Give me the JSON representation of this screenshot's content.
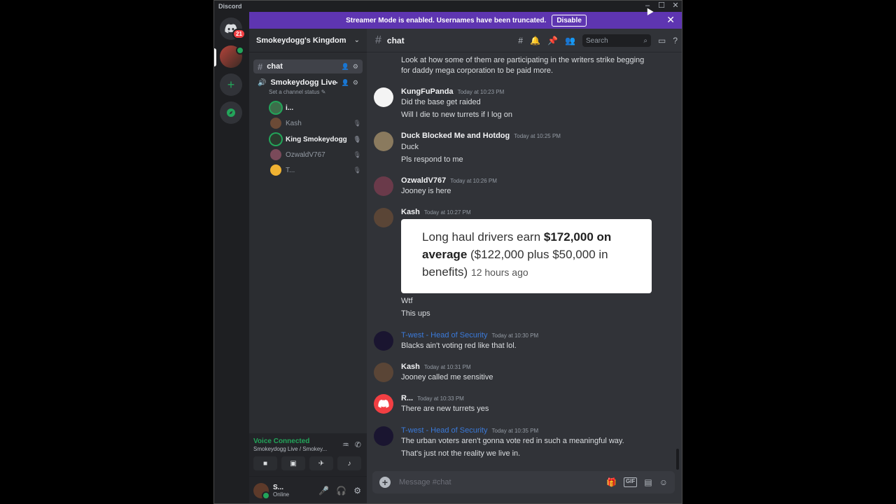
{
  "window": {
    "title": "Discord"
  },
  "rail": {
    "dm_badge": "21"
  },
  "banner": {
    "text": "Streamer Mode is enabled. Usernames have been truncated.",
    "button": "Disable"
  },
  "sidebar": {
    "server_name": "Smokeydogg's Kingdom",
    "text_channel": "chat",
    "voice_channel": "Smokeydogg Live",
    "voice_status": "Set a channel status",
    "voice_users": [
      "i...",
      "Kash",
      "King Smokeydogg",
      "OzwaldV767",
      "T..."
    ]
  },
  "voice_panel": {
    "status": "Voice Connected",
    "location": "Smokeydogg Live / Smokey..."
  },
  "user": {
    "name": "S...",
    "status": "Online"
  },
  "header": {
    "channel": "chat",
    "search_placeholder": "Search"
  },
  "messages": [
    {
      "lines": [
        "Look at how some of them are participating in the writers strike begging",
        "for daddy mega corporation to be paid more."
      ]
    },
    {
      "author": "KungFuPanda",
      "time": "Today at 10:23 PM",
      "lines": [
        "Did the base get raided",
        "Will I die to new turrets if I log on"
      ]
    },
    {
      "author": "Duck Blocked Me and Hotdog",
      "time": "Today at 10:25 PM",
      "lines": [
        "Duck",
        "Pls respond to me"
      ]
    },
    {
      "author": "OzwaldV767",
      "time": "Today at 10:26 PM",
      "lines": [
        "Jooney is here"
      ]
    },
    {
      "author": "Kash",
      "time": "Today at 10:27 PM",
      "lines": [
        "Wtf",
        "This ups"
      ]
    },
    {
      "author": "T-west - Head of Security",
      "time": "Today at 10:30 PM",
      "lines": [
        "Blacks ain't voting red like that lol."
      ]
    },
    {
      "author": "Kash",
      "time": "Today at 10:31 PM",
      "lines": [
        "Jooney called me sensitive"
      ]
    },
    {
      "author": "R...",
      "time": "Today at 10:33 PM",
      "lines": [
        "There are new turrets yes"
      ]
    },
    {
      "author": "T-west - Head of Security",
      "time": "Today at 10:35 PM",
      "lines": [
        "The urban voters aren't gonna vote red in such a meaningful way.",
        "That's just not the reality we live in."
      ]
    }
  ],
  "embed": {
    "text_normal": "Long haul drivers earn ",
    "text_bold": "$172,000 on average",
    "text_rest": " ($122,000 plus $50,000 in benefits) ",
    "ago": "12 hours ago"
  },
  "composer": {
    "placeholder": "Message #chat"
  },
  "colors": {
    "brand": "#5865f2",
    "banner": "#5e35b1",
    "online": "#23a55a",
    "role_blue": "#3b7ad9"
  }
}
